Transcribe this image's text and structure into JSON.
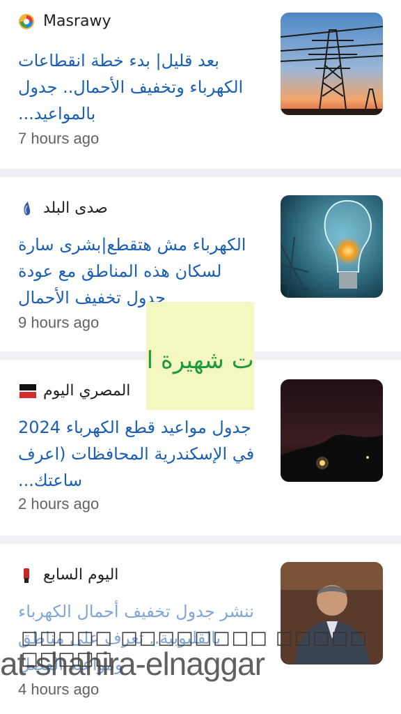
{
  "feed": [
    {
      "source": "Masrawy",
      "headline": "بعد قليل| بدء خطة انقطاعات الكهرباء وتخفيف الأحمال.. جدول بالمواعيد...",
      "time": "7 hours ago",
      "source_icon": "masrawy-logo-icon",
      "thumb": "power-tower-sunset-image"
    },
    {
      "source": "صدى البلد",
      "headline": "الكهرباء مش هتقطع|بشرى سارة لسكان هذه المناطق مع عودة جدول تخفيف الأحمال",
      "time": "9 hours ago",
      "source_icon": "sada-elbalad-logo-icon",
      "thumb": "lightbulb-storm-image"
    },
    {
      "source": "المصري اليوم",
      "headline": "جدول مواعيد قطع الكهرباء 2024 في الإسكندرية المحافظات (اعرف ساعتك...",
      "time": "2 hours ago",
      "source_icon": "almasry-alyoum-logo-icon",
      "thumb": "dark-street-night-image"
    },
    {
      "source": "اليوم السابع",
      "headline": "ننشر جدول تخفيف أحمال الكهرباء بالقليوبية.. تعرف على مناطق ومواعيد الفصل",
      "time": "4 hours ago",
      "source_icon": "youm7-logo-icon",
      "thumb": "man-in-suit-image"
    }
  ],
  "watermark": {
    "logo_text": "حكايات شهيرة النجار",
    "boxes": "□□□□□ □□□□□□□□ □□□□□ □□□□□",
    "url": "at-shahira-elnaggar"
  },
  "colors": {
    "headline": "#1a5fb4",
    "time": "#5f6368",
    "separator": "#eef0f3",
    "logo_bg": "#f4f7c2",
    "logo_green": "#1f9a3a"
  }
}
